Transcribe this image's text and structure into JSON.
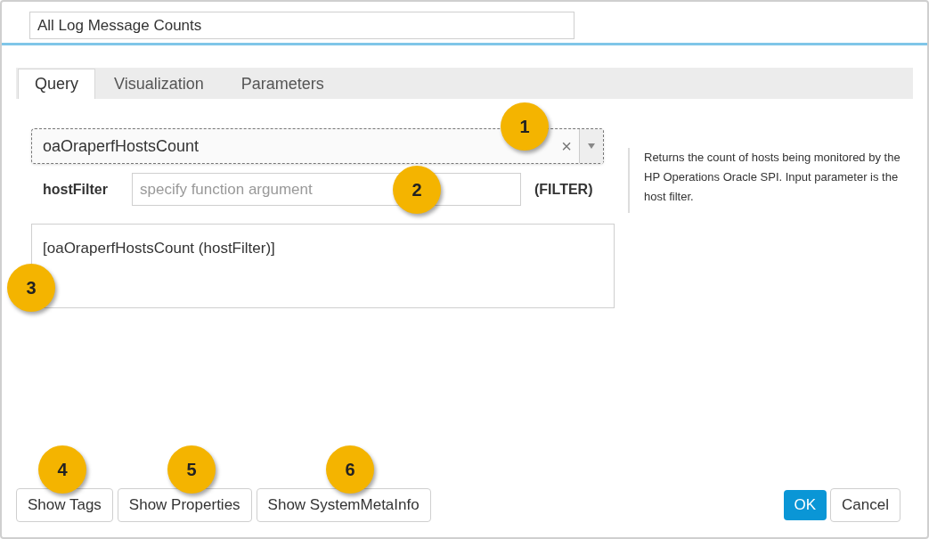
{
  "title_field": {
    "value": "All Log Message Counts"
  },
  "tabs": [
    {
      "label": "Query",
      "selected": true
    },
    {
      "label": "Visualization",
      "selected": false
    },
    {
      "label": "Parameters",
      "selected": false
    }
  ],
  "function_select": {
    "value": "oaOraperfHostsCount",
    "clear": "×"
  },
  "argument": {
    "label": "hostFilter",
    "placeholder": "specify function argument",
    "type": "(FILTER)"
  },
  "description": "Returns the count of hosts being monitored by the HP Operations Oracle SPI. Input parameter is the host filter.",
  "query_text": "[oaOraperfHostsCount (hostFilter)]",
  "left_buttons": [
    "Show Tags",
    "Show Properties",
    "Show SystemMetaInfo"
  ],
  "ok_button": "OK",
  "cancel_button": "Cancel",
  "callouts": [
    "1",
    "2",
    "3",
    "4",
    "5",
    "6"
  ]
}
